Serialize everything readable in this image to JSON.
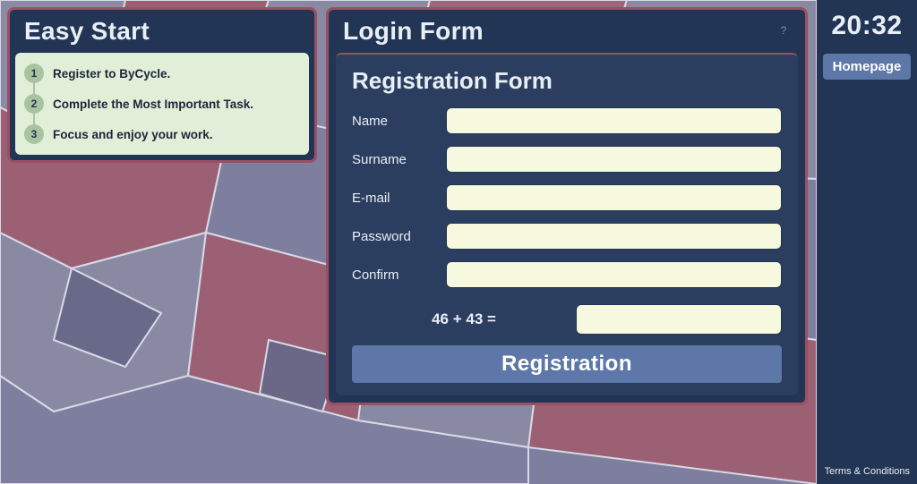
{
  "easy_start": {
    "title": "Easy Start",
    "steps": [
      {
        "num": "1",
        "text": "Register to ByCycle."
      },
      {
        "num": "2",
        "text": "Complete the Most Important Task."
      },
      {
        "num": "3",
        "text": "Focus and enjoy your work."
      }
    ]
  },
  "login": {
    "title": "Login Form",
    "help": "?",
    "registration_title": "Registration Form",
    "fields": {
      "name_label": "Name",
      "surname_label": "Surname",
      "email_label": "E-mail",
      "password_label": "Password",
      "confirm_label": "Confirm"
    },
    "captcha_question": "46 + 43 =",
    "submit_label": "Registration"
  },
  "sidebar": {
    "clock": "20:32",
    "homepage_label": "Homepage",
    "terms_label": "Terms & Conditions"
  }
}
